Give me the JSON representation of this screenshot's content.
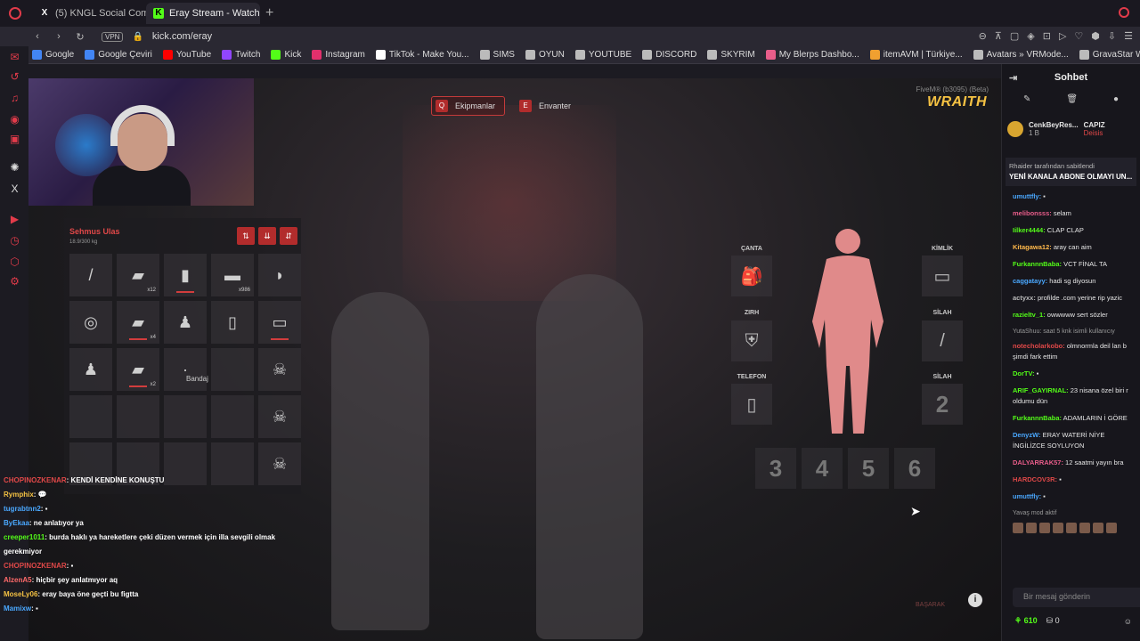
{
  "browser": {
    "tabs": [
      {
        "label": "(5) KNGL Social Commun",
        "icon": "x-icon"
      },
      {
        "label": "Eray Stream - Watch L",
        "icon": "kick-icon"
      }
    ],
    "url": "kick.com/eray",
    "vpn": "VPN"
  },
  "bookmarks": [
    {
      "label": "Google",
      "color": "#4285f4"
    },
    {
      "label": "Google Çeviri",
      "color": "#4285f4"
    },
    {
      "label": "YouTube",
      "color": "#ff0000"
    },
    {
      "label": "Twitch",
      "color": "#9146ff"
    },
    {
      "label": "Kick",
      "color": "#53fc18"
    },
    {
      "label": "Instagram",
      "color": "#e1306c"
    },
    {
      "label": "TikTok - Make You...",
      "color": "#ffffff"
    },
    {
      "label": "SIMS",
      "color": "#bbbbbb"
    },
    {
      "label": "OYUN",
      "color": "#bbbbbb"
    },
    {
      "label": "YOUTUBE",
      "color": "#bbbbbb"
    },
    {
      "label": "DISCORD",
      "color": "#bbbbbb"
    },
    {
      "label": "SKYRIM",
      "color": "#bbbbbb"
    },
    {
      "label": "My Blerps Dashbo...",
      "color": "#e85d8a"
    },
    {
      "label": "itemAVM | Türkiye...",
      "color": "#f0a030"
    },
    {
      "label": "Avatars » VRMode...",
      "color": "#bbbbbb"
    },
    {
      "label": "GravaStar Web-ba...",
      "color": "#bbbbbb"
    }
  ],
  "game": {
    "top_buttons": [
      {
        "key": "Q",
        "label": "Ekipmanlar"
      },
      {
        "key": "E",
        "label": "Envanter"
      }
    ],
    "version": "FiveM® (b3095) (Beta)",
    "server_logo": "WRAITH",
    "inventory": {
      "player_name": "Sehmus Ulas",
      "weight": "18.9/300 kg",
      "sort_buttons": [
        "⇅",
        "⇊",
        "⇵"
      ],
      "slots": [
        {
          "icon": "knife-icon",
          "glyph": "/",
          "qty": "",
          "durability": false
        },
        {
          "icon": "bandage-icon",
          "glyph": "▰",
          "qty": "x12",
          "durability": false
        },
        {
          "icon": "can-icon",
          "glyph": "▮",
          "qty": "",
          "durability": true
        },
        {
          "icon": "gold-icon",
          "glyph": "▬",
          "qty": "x986",
          "durability": false
        },
        {
          "icon": "cap-icon",
          "glyph": "◗",
          "qty": "",
          "durability": false
        },
        {
          "icon": "donut-icon",
          "glyph": "◎",
          "qty": "",
          "durability": false
        },
        {
          "icon": "bandage-icon",
          "glyph": "▰",
          "qty": "x4",
          "durability": true
        },
        {
          "icon": "figure-icon",
          "glyph": "♟",
          "qty": "",
          "durability": false
        },
        {
          "icon": "bottle-icon",
          "glyph": "▯",
          "qty": "",
          "durability": false
        },
        {
          "icon": "card-icon",
          "glyph": "▭",
          "qty": "",
          "durability": true
        },
        {
          "icon": "figure-icon",
          "glyph": "♟",
          "qty": "",
          "durability": false
        },
        {
          "icon": "bandage-icon",
          "glyph": "▰",
          "qty": "x2",
          "durability": true
        },
        {
          "icon": "dot-icon",
          "glyph": "·",
          "qty": "",
          "durability": false
        },
        {
          "icon": "empty",
          "glyph": "",
          "qty": "",
          "durability": false
        },
        {
          "icon": "skull-icon",
          "glyph": "☠",
          "qty": "",
          "durability": false
        },
        {
          "icon": "empty",
          "glyph": "",
          "qty": "",
          "durability": false
        },
        {
          "icon": "empty",
          "glyph": "",
          "qty": "",
          "durability": false
        },
        {
          "icon": "empty",
          "glyph": "",
          "qty": "",
          "durability": false
        },
        {
          "icon": "empty",
          "glyph": "",
          "qty": "",
          "durability": false
        },
        {
          "icon": "skull-icon",
          "glyph": "☠",
          "qty": "",
          "durability": false
        },
        {
          "icon": "empty",
          "glyph": "",
          "qty": "",
          "durability": false
        },
        {
          "icon": "empty",
          "glyph": "",
          "qty": "",
          "durability": false
        },
        {
          "icon": "empty",
          "glyph": "",
          "qty": "",
          "durability": false
        },
        {
          "icon": "empty",
          "glyph": "",
          "qty": "",
          "durability": false
        },
        {
          "icon": "skull-icon",
          "glyph": "☠",
          "qty": "",
          "durability": false
        }
      ],
      "tooltip": "Bandaj"
    },
    "equipment": {
      "canta": "ÇANTA",
      "zirh": "ZIRH",
      "telefon": "TELEFON",
      "kimlik": "KİMLİK",
      "silah1": "SİLAH",
      "silah2": "SİLAH",
      "silah2_num": "2"
    },
    "hotbar": [
      "3",
      "4",
      "5",
      "6"
    ],
    "overlay_chat": [
      {
        "user": "CHOPINOZKENAR",
        "color": "#e04848",
        "text": ": KENDİ KENDİNE KONUŞTU"
      },
      {
        "user": "Rymphix",
        "color": "#f5c243",
        "text": ": 💬"
      },
      {
        "user": "tugrabtnn2",
        "color": "#4aa8ff",
        "text": ": ▪"
      },
      {
        "user": "ByEkaa",
        "color": "#4aa8ff",
        "text": ": ne anlatıyor ya"
      },
      {
        "user": "creeper1011",
        "color": "#53fc18",
        "text": ": burda haklı ya hareketlere çeki düzen vermek için illa sevgili olmak"
      },
      {
        "user": "",
        "color": "#ffffff",
        "text": "gerekmiyor"
      },
      {
        "user": "CHOPINOZKENAR",
        "color": "#e04848",
        "text": ": ▪"
      },
      {
        "user": "AlzenA5",
        "color": "#ff6a6a",
        "text": ": hiçbir şey anlatmıyor aq"
      },
      {
        "user": "MoseLy06",
        "color": "#f5c243",
        "text": ": eray baya öne geçti bu figtta"
      },
      {
        "user": "Mamixw",
        "color": "#4aa8ff",
        "text": ": ▪"
      }
    ],
    "basarak": "BAŞARAK"
  },
  "chat": {
    "title": "Sohbet",
    "gift_user": "CenkBeyRes...",
    "gift_amount": "1 B",
    "gift_user2": "CAPIZ",
    "gift_user2_sub": "Deisis",
    "pinned_by": "Rhaider tarafından sabitlendi",
    "pinned_text": "YENİ KANALA ABONE OLMAYI UN...",
    "messages": [
      {
        "user": "umuttfly:",
        "color": "#4aa8ff",
        "text": " ▪"
      },
      {
        "user": "melibonsss:",
        "color": "#e85d8a",
        "text": " selam"
      },
      {
        "user": "Iilker4444:",
        "color": "#53fc18",
        "text": " CLAP CLAP"
      },
      {
        "user": "Kitagawa12:",
        "color": "#ffb84a",
        "text": " aray can aim"
      },
      {
        "user": "FurkannnBaba:",
        "color": "#53fc18",
        "text": " VCT FİNAL TA"
      },
      {
        "user": "caggatayy:",
        "color": "#4aa8ff",
        "text": " hadi sg diyosun"
      },
      {
        "user": "actyxx:",
        "color": "#bbbbbb",
        "text": " profilde .com yerine rip yazic"
      },
      {
        "user": "razieltv_1:",
        "color": "#53fc18",
        "text": " owwwww sert sözler"
      },
      {
        "user": "notecholarkobo:",
        "color": "#e04848",
        "text": " olmnormla deil lan b şimdi fark ettim"
      },
      {
        "user": "DorTV:",
        "color": "#53fc18",
        "text": " ▪"
      },
      {
        "user": "ARIF_GAYIRNAL:",
        "color": "#53fc18",
        "text": " 23 nisana özel biri r oldumu dün"
      },
      {
        "user": "FurkannnBaba:",
        "color": "#53fc18",
        "text": " ADAMLARIN İ GÖRE"
      },
      {
        "user": "DenyzW:",
        "color": "#4aa8ff",
        "text": " ERAY WATERİ NİYE İNGİLİZCE SOYLUYON"
      },
      {
        "user": "DALYARRAK57:",
        "color": "#e85d8a",
        "text": " 12 saatmi yayın bra"
      },
      {
        "user": "HARDCOV3R:",
        "color": "#e04848",
        "text": " ▪"
      },
      {
        "user": "umuttfly:",
        "color": "#4aa8ff",
        "text": " ▪"
      }
    ],
    "reply_note": "YutaShuu: saat 5 knk isimli kullanıcıy",
    "slow_mode": "Yavaş mod aktif",
    "input_placeholder": "Bir mesaj gönderin",
    "points": "610",
    "badge_count": "0"
  }
}
